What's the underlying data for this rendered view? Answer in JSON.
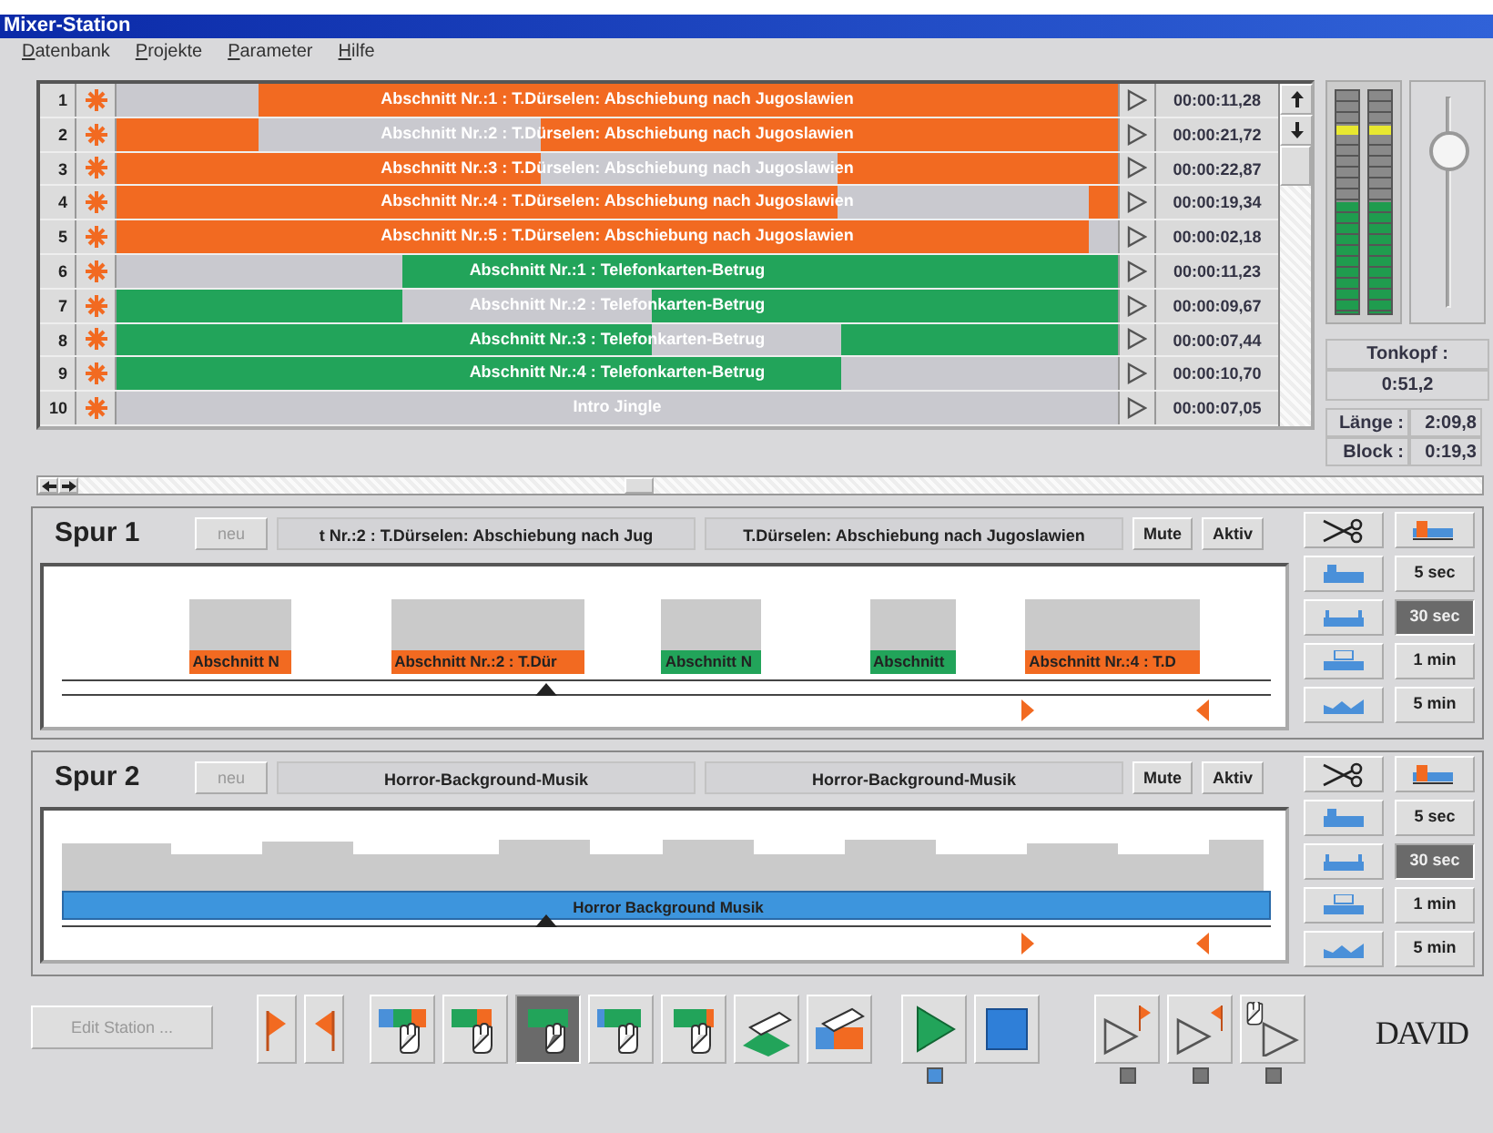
{
  "window": {
    "title": "Mixer-Station"
  },
  "menu": [
    "Datenbank",
    "Projekte",
    "Parameter",
    "Hilfe"
  ],
  "clip_list": {
    "rows": [
      {
        "number": "1",
        "label": "Abschnitt Nr.:1 : T.Dürselen: Abschiebung nach Jugoslawien",
        "color": "#f26a21",
        "time": "00:00:11,28",
        "gap_end": {
          "level": 0.142
        }
      },
      {
        "number": "2",
        "label": "Abschnitt Nr.:2 : T.Dürselen: Abschiebung nach Jugoslawien",
        "color": "#f26a21",
        "time": "00:00:21,72",
        "lead": {
          "level": 0.142
        },
        "gap_end": {
          "level": 0.424
        }
      },
      {
        "number": "3",
        "label": "Abschnitt Nr.:3 : T.Dürselen: Abschiebung nach Jugoslawien",
        "color": "#f26a21",
        "time": "00:00:22,87",
        "lead": {
          "level": 0.424
        },
        "gap_end": {
          "level": 0.72
        }
      },
      {
        "number": "4",
        "label": "Abschnitt Nr.:4 : T.Dürselen: Abschiebung nach Jugoslawien",
        "color": "#f26a21",
        "time": "00:00:19,34",
        "lead": {
          "level": 0.72
        },
        "gap_end": {
          "level": 0.971
        }
      },
      {
        "number": "5",
        "label": "Abschnitt Nr.:5 : T.Dürselen: Abschiebung nach Jugoslawien",
        "color": "#f26a21",
        "time": "00:00:02,18",
        "lead": {
          "level": 0.971
        }
      },
      {
        "number": "6",
        "label": "Abschnitt Nr.:1 : Telefonkarten-Betrug",
        "color": "#22a45a",
        "time": "00:00:11,23",
        "gap_end": {
          "level": 0.285
        }
      },
      {
        "number": "7",
        "label": "Abschnitt Nr.:2 : Telefonkarten-Betrug",
        "color": "#22a45a",
        "time": "00:00:09,67",
        "lead": {
          "level": 0.285
        },
        "gap_end": {
          "level": 0.535
        }
      },
      {
        "number": "8",
        "label": "Abschnitt Nr.:3 : Telefonkarten-Betrug",
        "color": "#22a45a",
        "time": "00:00:07,44",
        "lead": {
          "level": 0.535
        },
        "gap_end": {
          "level": 0.724
        }
      },
      {
        "number": "9",
        "label": "Abschnitt Nr.:4 : Telefonkarten-Betrug",
        "color": "#22a45a",
        "time": "00:00:10,70",
        "lead": {
          "level": 0.724
        }
      },
      {
        "number": "10",
        "label": "Intro Jingle",
        "time": "00:00:07,05"
      }
    ]
  },
  "meters": [
    {
      "level": 0.5,
      "peak": {
        "level": 0.8
      }
    },
    {
      "level": 0.5,
      "peak": {
        "level": 0.8
      }
    }
  ],
  "fader": {
    "level": 0.75
  },
  "tonkopf": {
    "label": "Tonkopf :",
    "value": "0:51,2"
  },
  "info": [
    {
      "label": "Länge :",
      "value": "2:09,8"
    },
    {
      "label": "Block :",
      "value": "0:19,3"
    }
  ],
  "tracks": [
    {
      "kind": "segmented",
      "title": "Spur 1",
      "new_button": {
        "label": "neu",
        "disabled": true
      },
      "fields": [
        "t Nr.:2 : T.Dürselen: Abschiebung nach Jug",
        "T.Dürselen: Abschiebung nach Jugoslawien"
      ],
      "mute": "Mute",
      "active": "Aktiv",
      "clips": [
        {
          "label": "Abschnitt N",
          "color": "#f26a21"
        },
        {
          "label": "Abschnitt Nr.:2 : T.Dür",
          "color": "#f26a21"
        },
        {
          "label": "Abschnitt N",
          "color": "#22a45a"
        },
        {
          "label": "Abschnitt",
          "color": "#22a45a"
        },
        {
          "label": "Abschnitt Nr.:4 : T.D",
          "color": "#f26a21"
        }
      ],
      "playhead": {
        "level": 0.4
      },
      "mark_in": {
        "level": 0.8
      },
      "mark_out": {
        "level": 0.945
      },
      "zoom": [
        {
          "label": "5 sec",
          "selected": false
        },
        {
          "label": "30 sec",
          "selected": true
        },
        {
          "label": "1 min",
          "selected": false
        },
        {
          "label": "5 min",
          "selected": false
        }
      ]
    },
    {
      "kind": "continuous",
      "title": "Spur 2",
      "new_button": {
        "label": "neu",
        "disabled": true
      },
      "fields": [
        "Horror-Background-Musik",
        "Horror-Background-Musik"
      ],
      "mute": "Mute",
      "active": "Aktiv",
      "clips": [
        {
          "label": "Horror Background Musik",
          "color": "#3d95dd"
        }
      ],
      "playhead": {
        "level": 0.4
      },
      "mark_in": {
        "level": 0.8
      },
      "mark_out": {
        "level": 0.945
      },
      "zoom": [
        {
          "label": "5 sec",
          "selected": false
        },
        {
          "label": "30 sec",
          "selected": true
        },
        {
          "label": "1 min",
          "selected": false
        },
        {
          "label": "5 min",
          "selected": false
        }
      ]
    }
  ],
  "toolbar": {
    "edit_station": {
      "label": "Edit Station ...",
      "disabled": true
    },
    "markers": [
      {
        "kind": "in"
      },
      {
        "kind": "out"
      }
    ],
    "modes": [
      {
        "kind": "insert",
        "selected": false
      },
      {
        "kind": "push",
        "selected": false
      },
      {
        "kind": "move",
        "selected": true
      },
      {
        "kind": "trim_in",
        "selected": false
      },
      {
        "kind": "trim_out",
        "selected": false
      },
      {
        "kind": "lift",
        "selected": false
      },
      {
        "kind": "replace",
        "selected": false
      }
    ],
    "transport": [
      {
        "kind": "play",
        "lamp": {
          "color": "#4a90d9"
        }
      },
      {
        "kind": "stop"
      }
    ],
    "cue": [
      {
        "kind": "play_to_in",
        "lamp": {
          "color": "#777777"
        }
      },
      {
        "kind": "play_to_out",
        "lamp": {
          "color": "#777777"
        }
      },
      {
        "kind": "hand_play",
        "lamp": {
          "color": "#777777"
        }
      }
    ],
    "logo": "DAVID"
  }
}
